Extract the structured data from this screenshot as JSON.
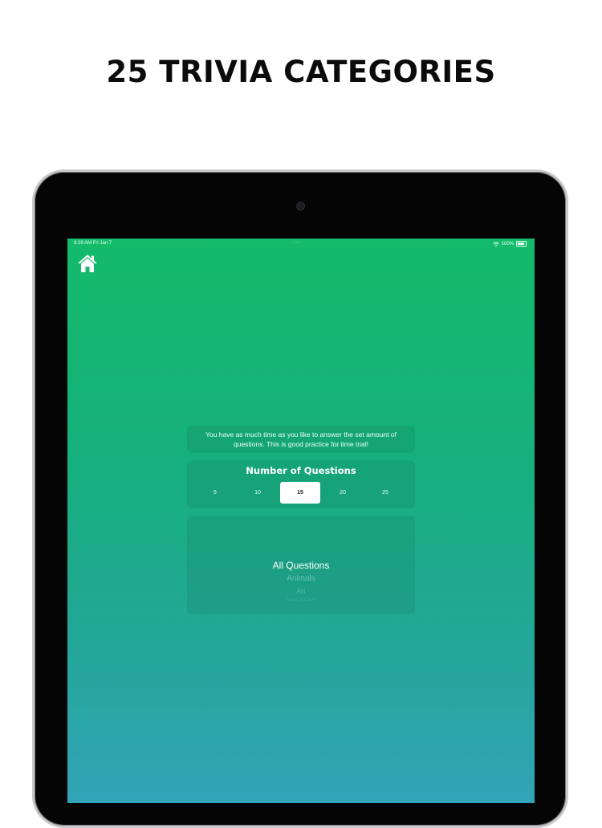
{
  "headline": "25 TRIVIA CATEGORIES",
  "status_bar": {
    "time": "8:29 AM   Fri Jan 7",
    "battery": "100%"
  },
  "description": "You have as much time as you like to answer the set amount of questions. This is good practice for time trial!",
  "questions": {
    "title": "Number of Questions",
    "options": [
      "5",
      "10",
      "15",
      "20",
      "25"
    ],
    "selected": "15"
  },
  "categories": [
    "All Questions",
    "Animals",
    "Art",
    "Brands & Logos"
  ],
  "colors": {
    "gradient_top": "#14bb6a",
    "gradient_bottom": "#33a4b8",
    "headline": "#0b0b0b"
  },
  "icons": {
    "home": "home-icon",
    "wifi": "wifi-icon",
    "battery": "battery-icon"
  }
}
